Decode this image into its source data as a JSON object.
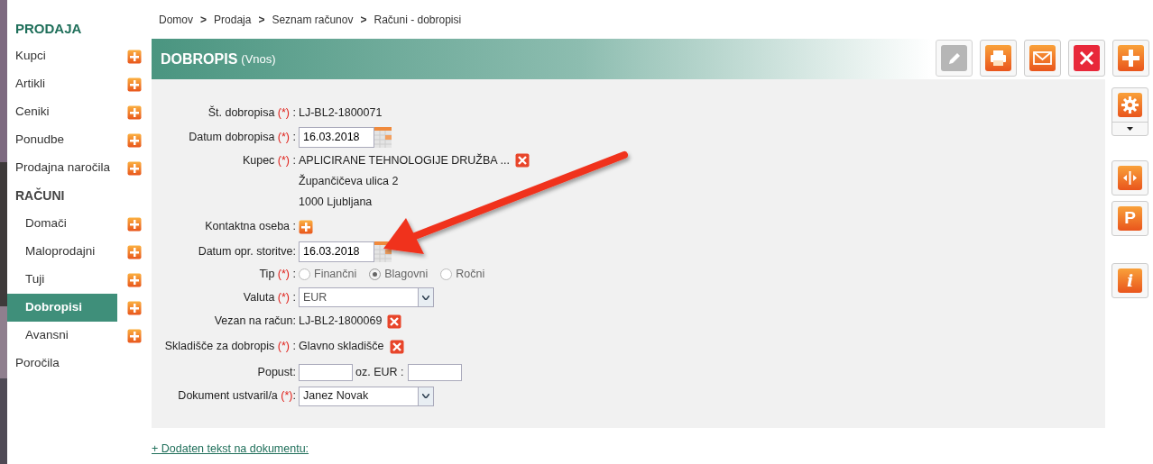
{
  "sidebar": {
    "items": [
      {
        "kind": "heading",
        "label": "PRODAJA"
      },
      {
        "kind": "item",
        "label": "Kupci",
        "add": true,
        "selected": false
      },
      {
        "kind": "item",
        "label": "Artikli",
        "add": true,
        "selected": false
      },
      {
        "kind": "item",
        "label": "Ceniki",
        "add": true,
        "selected": false
      },
      {
        "kind": "item",
        "label": "Ponudbe",
        "add": true,
        "selected": false
      },
      {
        "kind": "item",
        "label": "Prodajna naročila",
        "add": true,
        "selected": false
      },
      {
        "kind": "subheading",
        "label": "RAČUNI"
      },
      {
        "kind": "subitem",
        "label": "Domači",
        "add": true,
        "selected": false
      },
      {
        "kind": "subitem",
        "label": "Maloprodajni",
        "add": true,
        "selected": false
      },
      {
        "kind": "subitem",
        "label": "Tuji",
        "add": true,
        "selected": false
      },
      {
        "kind": "subitem",
        "label": "Dobropisi",
        "add": true,
        "selected": true
      },
      {
        "kind": "subitem",
        "label": "Avansni",
        "add": true,
        "selected": false
      },
      {
        "kind": "item",
        "label": "Poročila",
        "add": false,
        "selected": false
      }
    ]
  },
  "breadcrumb": [
    "Domov",
    "Prodaja",
    "Seznam računov",
    "Računi - dobropisi"
  ],
  "breadcrumb_separator": ">",
  "header": {
    "title": "DOBROPIS",
    "subtitle": "(Vnos)"
  },
  "toolbar": [
    {
      "kind": "edit",
      "disabled": true
    },
    {
      "kind": "print",
      "disabled": false
    },
    {
      "kind": "mail",
      "disabled": false
    },
    {
      "kind": "delete",
      "disabled": false
    },
    {
      "kind": "add",
      "disabled": false
    }
  ],
  "side_toolbar": [
    {
      "kind": "settings",
      "dropdown": true
    },
    {
      "kind": "split",
      "dropdown": false
    },
    {
      "kind": "letter",
      "label": "P",
      "dropdown": false
    },
    {
      "kind": "info",
      "label": "i",
      "dropdown": false
    }
  ],
  "form": {
    "rows": [
      {
        "kind": "text",
        "label": "Št. dobropisa",
        "mark": "(*)",
        "suffix": " :",
        "value": "LJ-BL2-1800071",
        "remove": false
      },
      {
        "kind": "date",
        "label": "Datum dobropisa",
        "mark": "(*)",
        "suffix": " :",
        "value": "16.03.2018"
      },
      {
        "kind": "text",
        "label": "Kupec",
        "mark": "(*)",
        "suffix": " :",
        "value": "APLICIRANE TEHNOLOGIJE DRUŽBA ...",
        "remove": true
      },
      {
        "kind": "line",
        "value": "Župančičeva ulica 2"
      },
      {
        "kind": "line",
        "value": "1000 Ljubljana"
      },
      {
        "kind": "add",
        "label": "Kontaktna oseba",
        "suffix": " :"
      },
      {
        "kind": "date",
        "label": "Datum opr. storitve:",
        "value": "16.03.2018"
      },
      {
        "kind": "radio",
        "label": "Tip",
        "mark": "(*)",
        "suffix": " :",
        "options": [
          {
            "label": "Finančni",
            "selected": false
          },
          {
            "label": "Blagovni",
            "selected": true
          },
          {
            "label": "Ročni",
            "selected": false
          }
        ]
      },
      {
        "kind": "select",
        "label": "Valuta",
        "mark": "(*)",
        "suffix": " :",
        "value": "EUR",
        "disabled": true
      },
      {
        "kind": "text",
        "label": "Vezan na račun:",
        "value": "LJ-BL2-1800069",
        "remove": true
      },
      {
        "kind": "text",
        "label": "Skladišče za dobropis",
        "mark": "(*)",
        "suffix": " :",
        "value": "Glavno skladišče",
        "remove": true
      },
      {
        "kind": "discount",
        "label": "Popust:",
        "second_label": "oz. EUR :"
      },
      {
        "kind": "select",
        "label": "Dokument ustvaril/a",
        "mark": "(*)",
        "suffix": ":",
        "value": "Janez Novak",
        "disabled": false
      }
    ]
  },
  "footer_link": "+ Dodaten tekst na dokumentu:"
}
